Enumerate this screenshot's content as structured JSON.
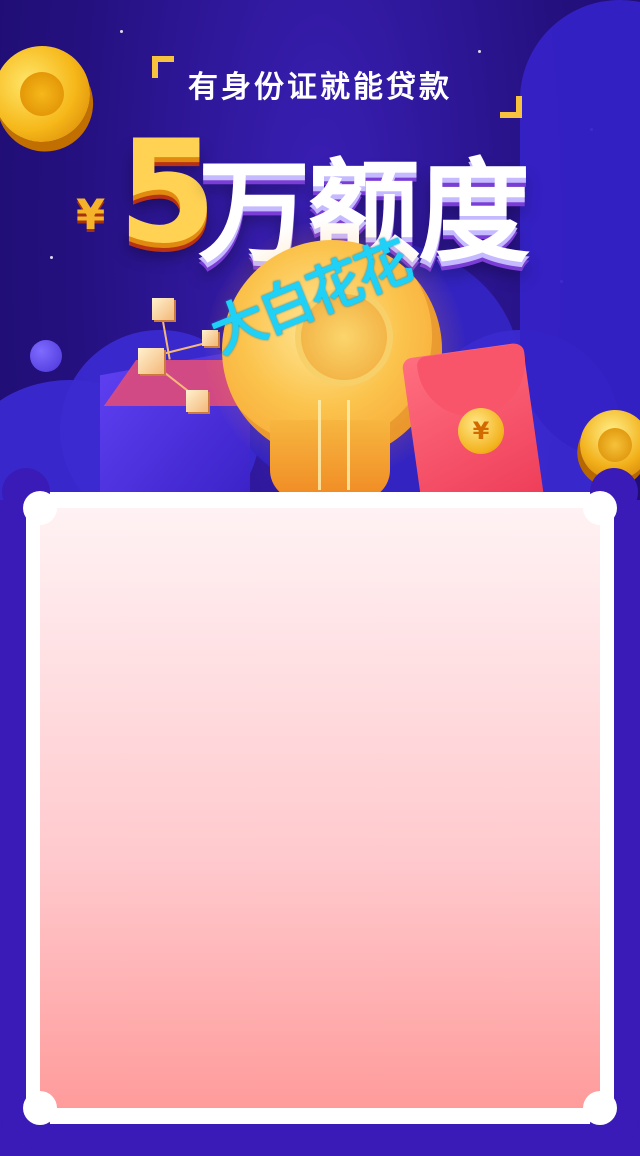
{
  "poster": {
    "slogan": "有身份证就能贷款",
    "headline": {
      "currency": "¥",
      "amount": "5",
      "unit": "万额度"
    },
    "watermark": "大白花花",
    "envelope_coin_symbol": "¥"
  },
  "colors": {
    "background": "#24107e",
    "gold": "#ffd254",
    "accent_red": "#ee3c58",
    "panel_gradient_top": "#fff2f4",
    "panel_gradient_bottom": "#ff9b9b",
    "watermark": "#1fd0f7"
  }
}
